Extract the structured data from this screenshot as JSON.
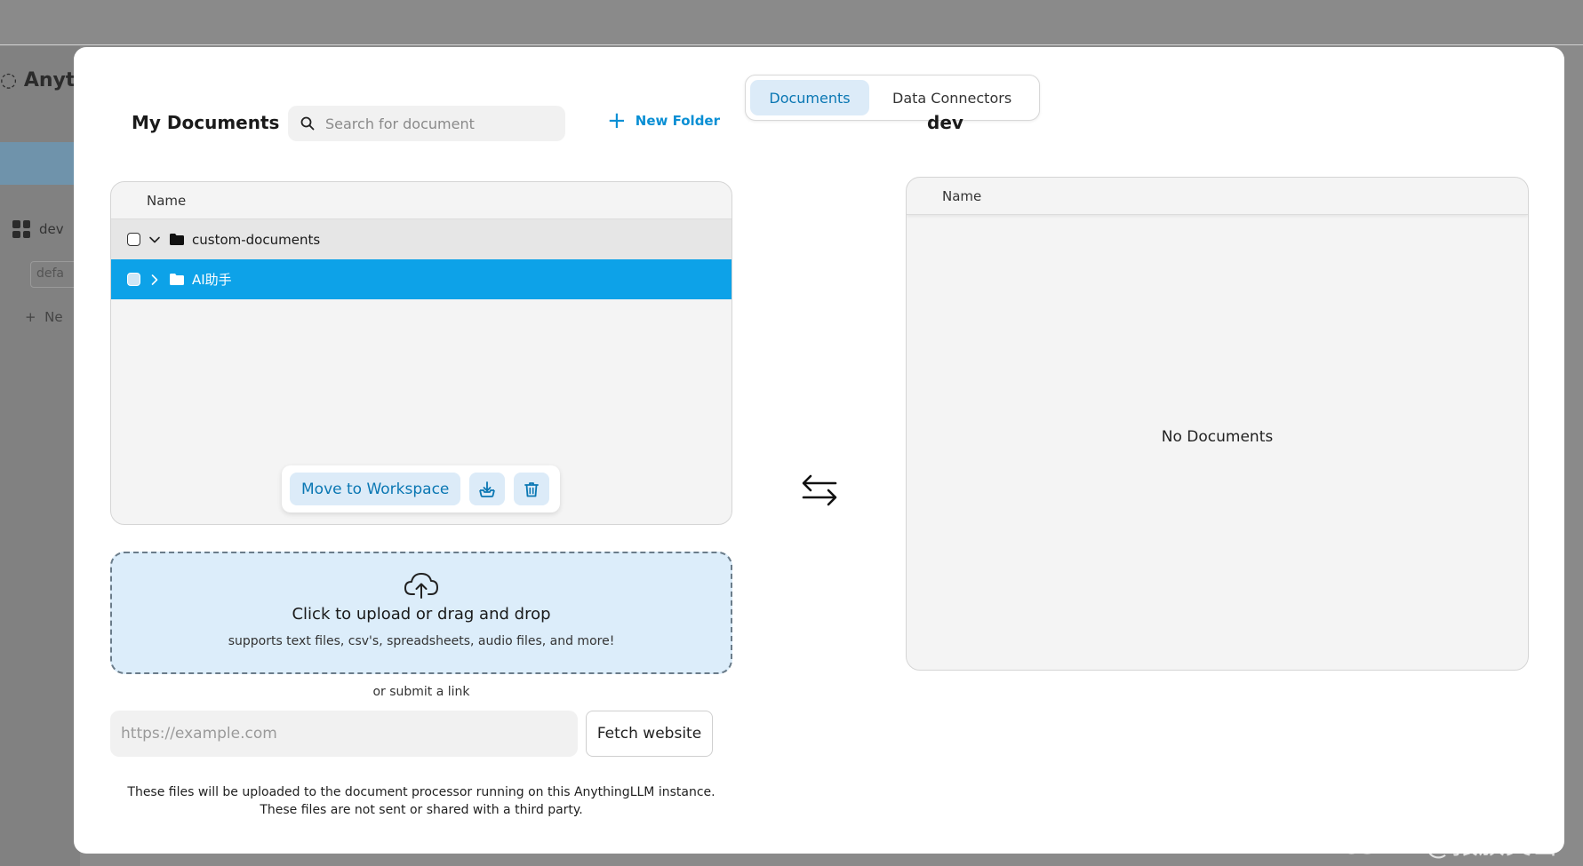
{
  "background": {
    "logo_text": "Anyt",
    "workspace_label": "dev",
    "input_text": "defa",
    "new_label": "Ne"
  },
  "tabs": [
    {
      "label": "Documents",
      "active": true
    },
    {
      "label": "Data Connectors",
      "active": false
    }
  ],
  "my_documents": {
    "title": "My Documents",
    "search_placeholder": "Search for document",
    "new_folder_label": "New Folder",
    "column_name": "Name",
    "rows": [
      {
        "name": "custom-documents",
        "expanded": true,
        "selected": false
      },
      {
        "name": "AI助手",
        "expanded": false,
        "selected": true
      }
    ],
    "actions": {
      "move_label": "Move to Workspace",
      "download_icon": "download-tray-icon",
      "delete_icon": "trash-icon"
    }
  },
  "upload": {
    "title": "Click to upload or drag and drop",
    "subtitle": "supports text files, csv's, spreadsheets, audio files, and more!",
    "or_link": "or submit a link",
    "url_placeholder": "https://example.com",
    "fetch_label": "Fetch website",
    "disclaimer_line1": "These files will be uploaded to the document processor running on this AnythingLLM instance.",
    "disclaimer_line2": "These files are not sent or shared with a third party."
  },
  "workspace": {
    "title": "dev",
    "column_name": "Name",
    "empty_text": "No Documents"
  },
  "watermark": "CSDN @猿族突击",
  "colors": {
    "accent": "#0da2e8",
    "accent_text": "#0a77b3",
    "accent_light": "#dcebf8"
  }
}
